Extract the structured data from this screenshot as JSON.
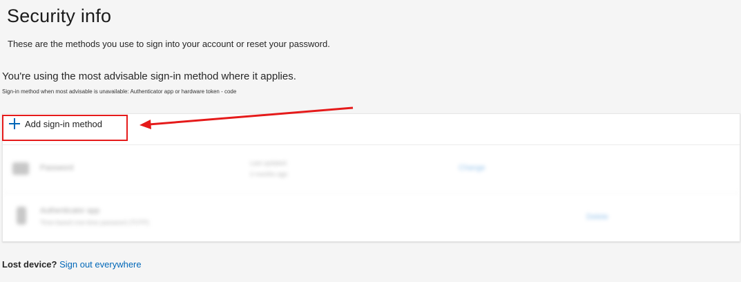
{
  "header": {
    "title": "Security info",
    "subtitle": "These are the methods you use to sign into your account or reset your password."
  },
  "status": {
    "advisable": "You're using the most advisable sign-in method where it applies.",
    "fallback": "Sign-in method when most advisable is unavailable: Authenticator app or hardware token - code"
  },
  "methods": {
    "add_label": "Add sign-in method",
    "items": [
      {
        "name": "Password",
        "detail": "Last updated:",
        "detail2": "2 months ago",
        "action": "Change"
      },
      {
        "name": "Authenticator app",
        "detail": "Time-based one-time password (TOTP)",
        "action": "Delete"
      }
    ]
  },
  "footer": {
    "lost_device": "Lost device?",
    "sign_out": "Sign out everywhere"
  },
  "annotation": {
    "color": "#e51a1a"
  },
  "colors": {
    "accent": "#0067b8",
    "background": "#f5f5f5"
  }
}
